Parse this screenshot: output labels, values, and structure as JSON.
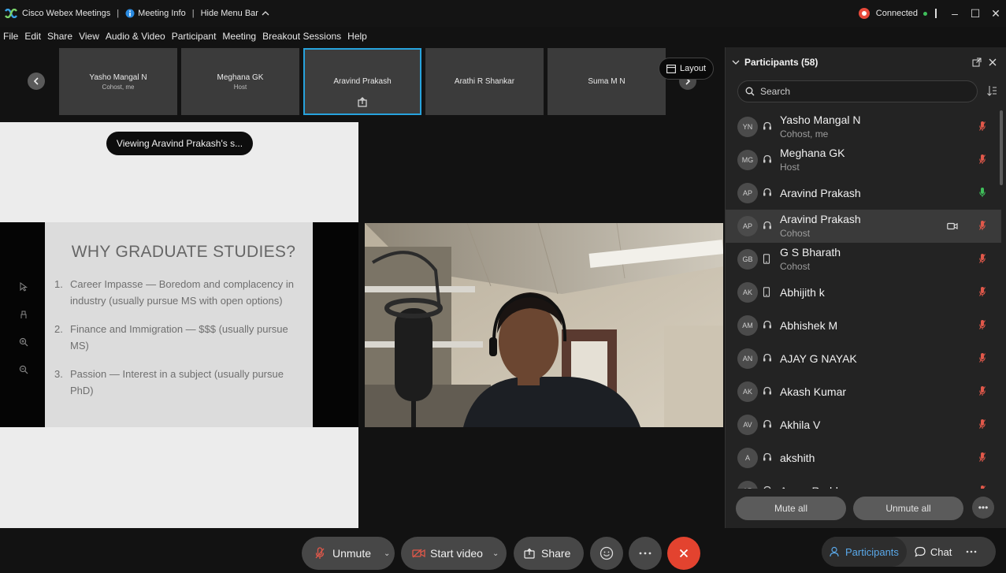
{
  "titlebar": {
    "app_name": "Cisco Webex Meetings",
    "sep1": "|",
    "meeting_info": "Meeting Info",
    "sep2": "|",
    "hide_menu_bar": "Hide Menu Bar",
    "connection_status": "Connected",
    "window_controls": [
      "–",
      "☐",
      "✕"
    ]
  },
  "menu": [
    "File",
    "Edit",
    "Share",
    "View",
    "Audio & Video",
    "Participant",
    "Meeting",
    "Breakout Sessions",
    "Help"
  ],
  "video_strip": [
    {
      "name": "Yasho Mangal N",
      "role": "Cohost, me",
      "active": false
    },
    {
      "name": "Meghana GK",
      "role": "Host",
      "active": false
    },
    {
      "name": "Aravind Prakash",
      "role": "",
      "active": true
    },
    {
      "name": "Arathi R Shankar",
      "role": "",
      "active": false
    },
    {
      "name": "Suma M N",
      "role": "",
      "active": false
    }
  ],
  "layout_button": "Layout",
  "share": {
    "viewing_label": "Viewing Aravind Prakash's s...",
    "slide": {
      "title": "WHY GRADUATE STUDIES?",
      "items": [
        {
          "num": "1.",
          "text": "Career Impasse — Boredom and complacency in industry (usually pursue MS with open options)"
        },
        {
          "num": "2.",
          "text": "Finance and Immigration — $$$ (usually pursue MS)"
        },
        {
          "num": "3.",
          "text": "Passion — Interest in a subject (usually pursue PhD)"
        }
      ]
    }
  },
  "participants_panel": {
    "title": "Participants (58)",
    "search_placeholder": "Search",
    "rows": [
      {
        "initials": "YN",
        "name": "Yasho Mangal N",
        "role": "Cohost, me",
        "device": "headset-icon",
        "mic": "muted",
        "camera": false,
        "selected": false
      },
      {
        "initials": "MG",
        "name": "Meghana GK",
        "role": "Host",
        "device": "headset-icon",
        "mic": "muted",
        "camera": false,
        "selected": false
      },
      {
        "initials": "AP",
        "name": "Aravind Prakash",
        "role": "",
        "device": "headset-icon",
        "mic": "active",
        "camera": false,
        "selected": false
      },
      {
        "initials": "AP",
        "name": "Aravind Prakash",
        "role": "Cohost",
        "device": "headset-icon",
        "mic": "muted",
        "camera": true,
        "selected": true
      },
      {
        "initials": "GB",
        "name": "G S Bharath",
        "role": "Cohost",
        "device": "phone-icon",
        "mic": "muted",
        "camera": false,
        "selected": false
      },
      {
        "initials": "AK",
        "name": "Abhijith k",
        "role": "",
        "device": "phone-icon",
        "mic": "muted",
        "camera": false,
        "selected": false
      },
      {
        "initials": "AM",
        "name": "Abhishek M",
        "role": "",
        "device": "headset-icon",
        "mic": "muted",
        "camera": false,
        "selected": false
      },
      {
        "initials": "AN",
        "name": "AJAY G NAYAK",
        "role": "",
        "device": "headset-icon",
        "mic": "muted",
        "camera": false,
        "selected": false
      },
      {
        "initials": "AK",
        "name": "Akash Kumar",
        "role": "",
        "device": "headset-icon",
        "mic": "muted",
        "camera": false,
        "selected": false
      },
      {
        "initials": "AV",
        "name": "Akhila V",
        "role": "",
        "device": "headset-icon",
        "mic": "muted",
        "camera": false,
        "selected": false
      },
      {
        "initials": "A",
        "name": "akshith",
        "role": "",
        "device": "headset-icon",
        "mic": "muted",
        "camera": false,
        "selected": false
      },
      {
        "initials": "AP",
        "name": "Aman Reddy",
        "role": "",
        "device": "headset-icon",
        "mic": "muted",
        "camera": false,
        "selected": false
      }
    ],
    "mute_all": "Mute all",
    "unmute_all": "Unmute all"
  },
  "controls": {
    "unmute": "Unmute",
    "start_video": "Start video",
    "share": "Share",
    "participants": "Participants",
    "chat": "Chat"
  },
  "colors": {
    "accent_blue": "#27a3dd",
    "end_red": "#e3432f",
    "mic_muted": "#e0584a",
    "mic_active": "#3fbf5a"
  }
}
